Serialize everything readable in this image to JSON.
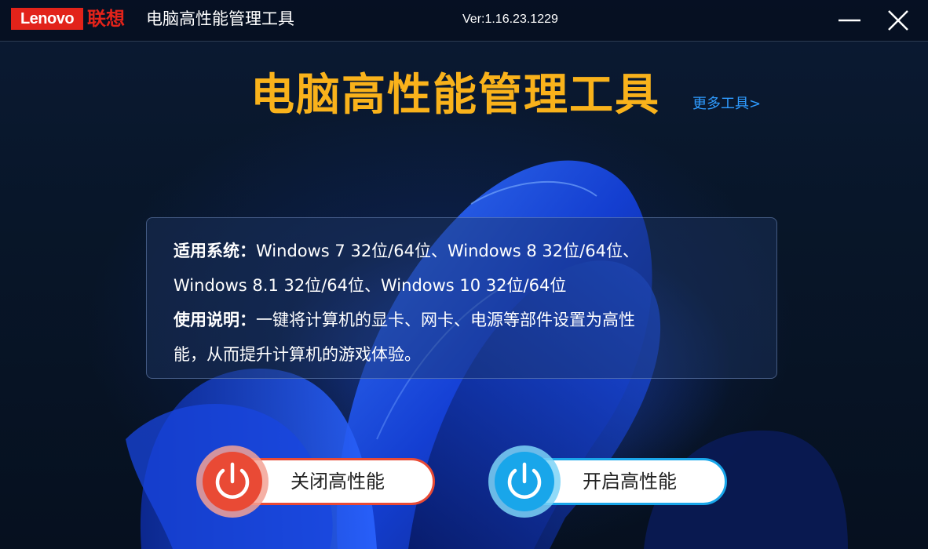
{
  "titlebar": {
    "logo_text": "Lenovo",
    "logo_cn": "联想",
    "app_title": "电脑高性能管理工具",
    "version": "Ver:1.16.23.1229",
    "minimize_icon": "minimize-icon",
    "close_icon": "close-icon"
  },
  "main": {
    "heading": "电脑高性能管理工具",
    "more_tools": "更多工具>"
  },
  "info": {
    "systems_label": "适用系统：",
    "systems_text": "Windows  7  32位/64位、Windows  8  32位/64位、",
    "systems_text2": "Windows 8.1 32位/64位、Windows 10 32位/64位",
    "usage_label": "使用说明：",
    "usage_text": "一键将计算机的显卡、网卡、电源等部件设置为高性",
    "usage_text2": "能，从而提升计算机的游戏体验。"
  },
  "buttons": {
    "disable_label": "关闭高性能",
    "enable_label": "开启高性能",
    "power_icon": "power-icon"
  },
  "colors": {
    "brand_red": "#e2231a",
    "heading_gold": "#f9b21b",
    "link_blue": "#2f9bff",
    "off_red": "#e94a35",
    "on_blue": "#19a6ea",
    "background": "#071327"
  }
}
